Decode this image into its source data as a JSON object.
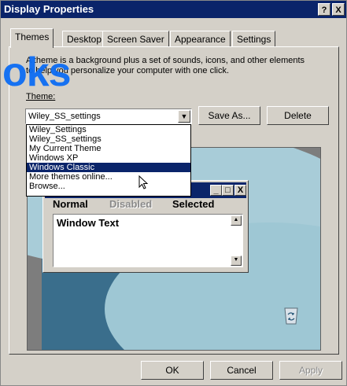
{
  "window": {
    "title": "Display Properties",
    "help_btn": "?",
    "close_btn": "X"
  },
  "tabs": [
    "Themes",
    "Desktop",
    "Screen Saver",
    "Appearance",
    "Settings"
  ],
  "themes_panel": {
    "description": "A theme is a background plus a set of sounds, icons, and other elements to help you personalize your computer with one click.",
    "theme_label": "Theme:",
    "selected_theme": "Wiley_SS_settings",
    "save_as": "Save As...",
    "delete": "Delete"
  },
  "dropdown_options": [
    "Wiley_Settings",
    "Wiley_SS_settings",
    "My Current Theme",
    "Windows XP",
    "Windows Classic",
    "More themes online...",
    "Browse..."
  ],
  "dropdown_highlighted": "Windows Classic",
  "preview": {
    "menu_normal": "Normal",
    "menu_disabled": "Disabled",
    "menu_selected": "Selected",
    "window_text": "Window Text",
    "min_btn": "_",
    "max_btn": "□",
    "close_btn": "X"
  },
  "footer": {
    "ok": "OK",
    "cancel": "Cancel",
    "apply": "Apply"
  },
  "watermark_text": "oks",
  "colors": {
    "titlebar": "#0a246a",
    "face": "#d4d0c8",
    "watermark": "#0c6cf4"
  }
}
